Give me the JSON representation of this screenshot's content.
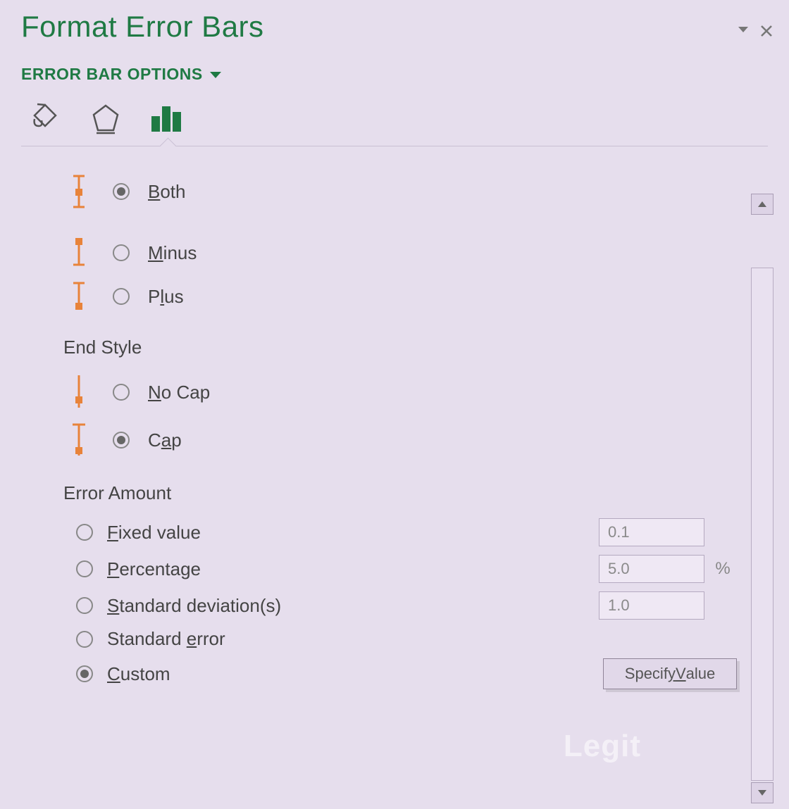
{
  "pane": {
    "title": "Format Error Bars"
  },
  "section_dropdown": {
    "label": "ERROR BAR OPTIONS"
  },
  "tabs": {
    "fill": "fill-line-icon",
    "effects": "effects-icon",
    "options": "bar-options-icon",
    "active": 2
  },
  "direction": {
    "options": [
      {
        "label_pre": "",
        "ul": "B",
        "label_post": "oth",
        "selected": true,
        "icon": "both"
      },
      {
        "label_pre": "",
        "ul": "M",
        "label_post": "inus",
        "selected": false,
        "icon": "minus"
      },
      {
        "label_pre": "P",
        "ul": "l",
        "label_post": "us",
        "selected": false,
        "icon": "plus"
      }
    ]
  },
  "end_style": {
    "heading": "End Style",
    "options": [
      {
        "label_pre": "",
        "ul": "N",
        "label_post": "o Cap",
        "selected": false,
        "icon": "nocap"
      },
      {
        "label_pre": "C",
        "ul": "a",
        "label_post": "p",
        "selected": true,
        "icon": "cap"
      }
    ]
  },
  "error_amount": {
    "heading": "Error Amount",
    "options": [
      {
        "label_pre": "",
        "ul": "F",
        "label_post": "ixed value",
        "selected": false,
        "value": "0.1",
        "suffix": ""
      },
      {
        "label_pre": "",
        "ul": "P",
        "label_post": "ercentage",
        "selected": false,
        "value": "5.0",
        "suffix": "%"
      },
      {
        "label_pre": "",
        "ul": "S",
        "label_post": "tandard deviation(s)",
        "selected": false,
        "value": "1.0",
        "suffix": ""
      },
      {
        "label_pre": "Standard ",
        "ul": "e",
        "label_post": "rror",
        "selected": false
      },
      {
        "label_pre": "",
        "ul": "C",
        "label_post": "ustom",
        "selected": true,
        "button_pre": "Specif",
        "button_ul": "y",
        "button_mid": " ",
        "button_ul2": "V",
        "button_post": "alue"
      }
    ]
  },
  "watermark": "Legit"
}
